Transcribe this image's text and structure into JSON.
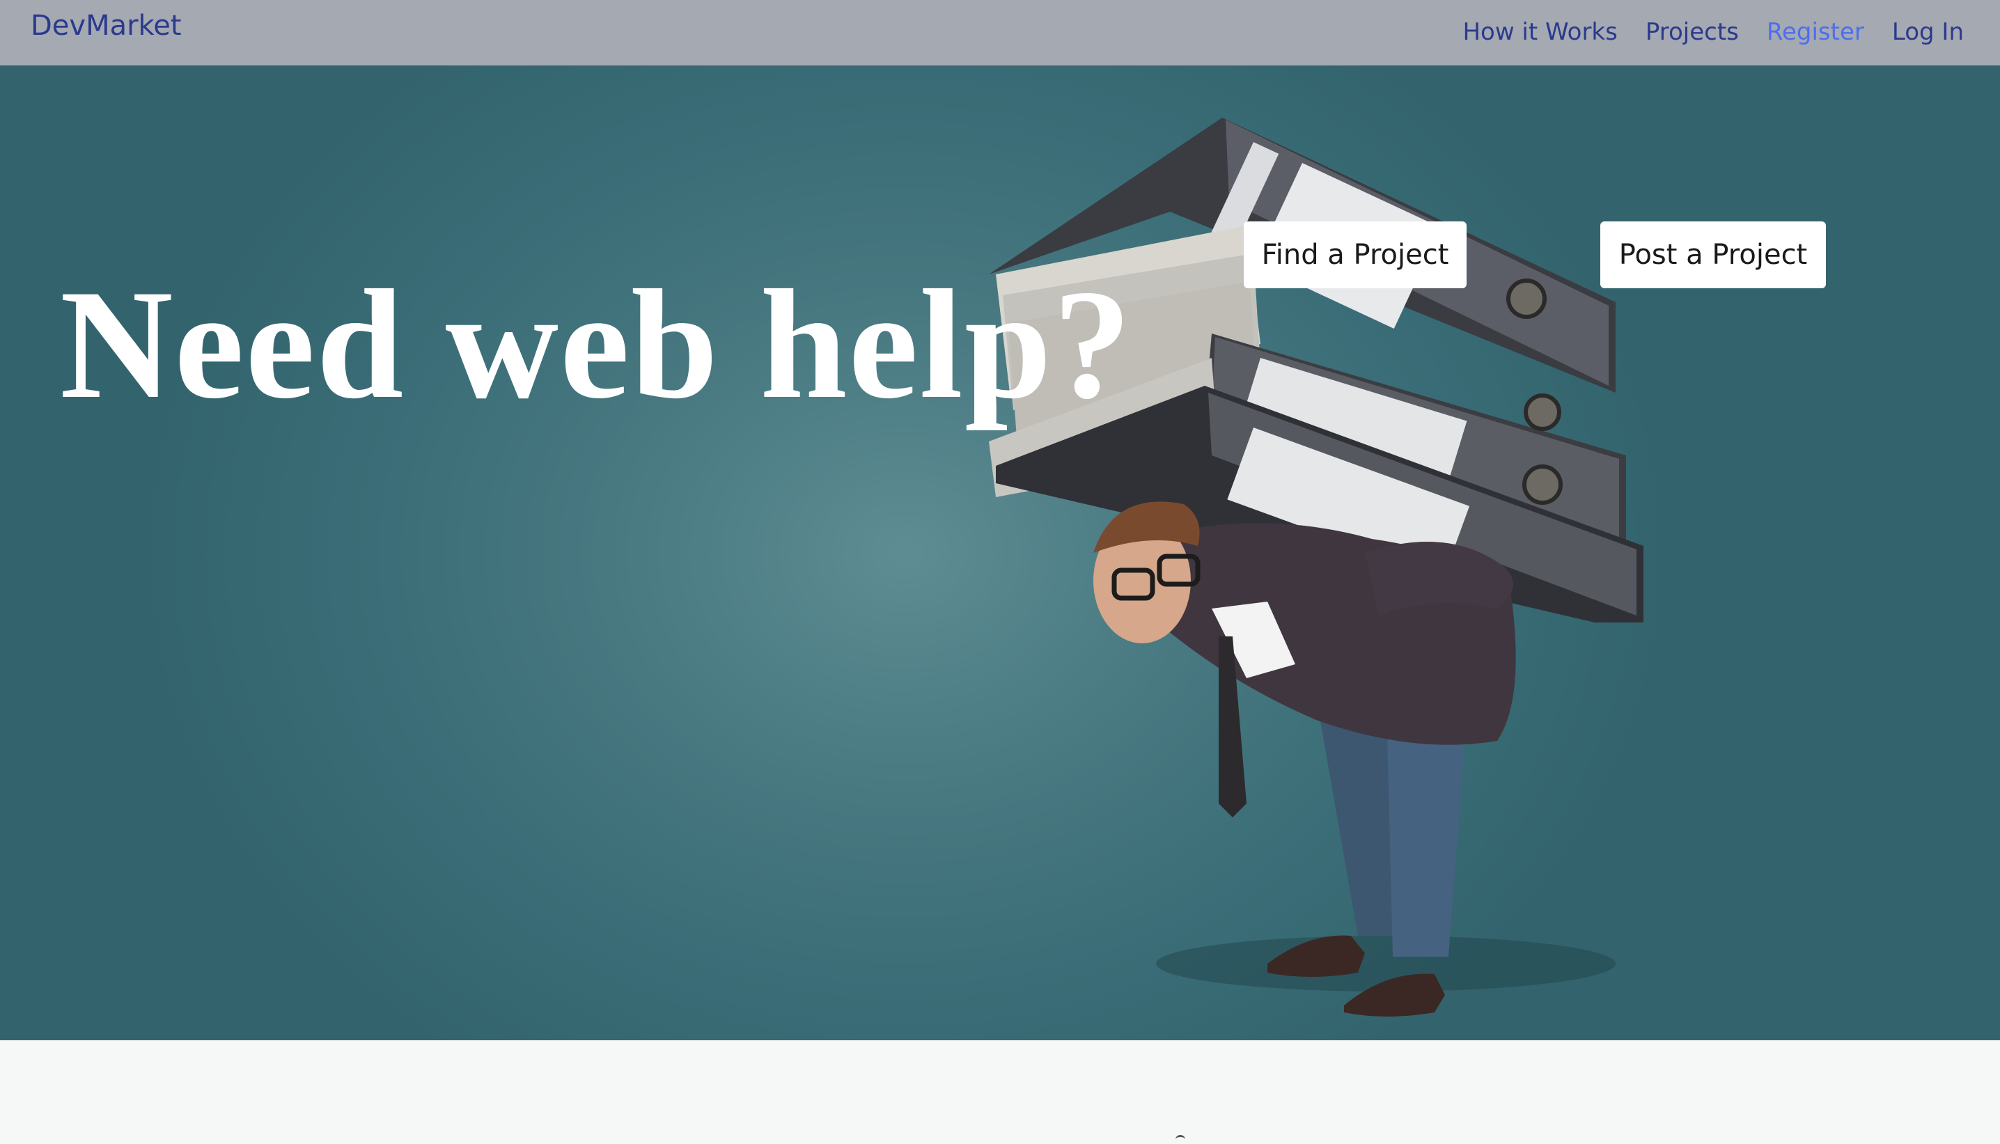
{
  "navbar": {
    "brand": "DevMarket",
    "links": [
      {
        "label": "How it Works"
      },
      {
        "label": "Projects"
      },
      {
        "label": "Register",
        "active": true
      },
      {
        "label": "Log In"
      }
    ]
  },
  "hero": {
    "title": "Need web help?",
    "buttons": {
      "find": "Find a Project",
      "post": "Post a Project"
    },
    "image": "man-carrying-binders-illustration"
  },
  "colors": {
    "navbar_bg": "#a5a9b2",
    "brand": "#2b3a8c",
    "active_link": "#4d6ef0",
    "hero_bg": "#3a6d77",
    "button_bg": "#ffffff"
  }
}
